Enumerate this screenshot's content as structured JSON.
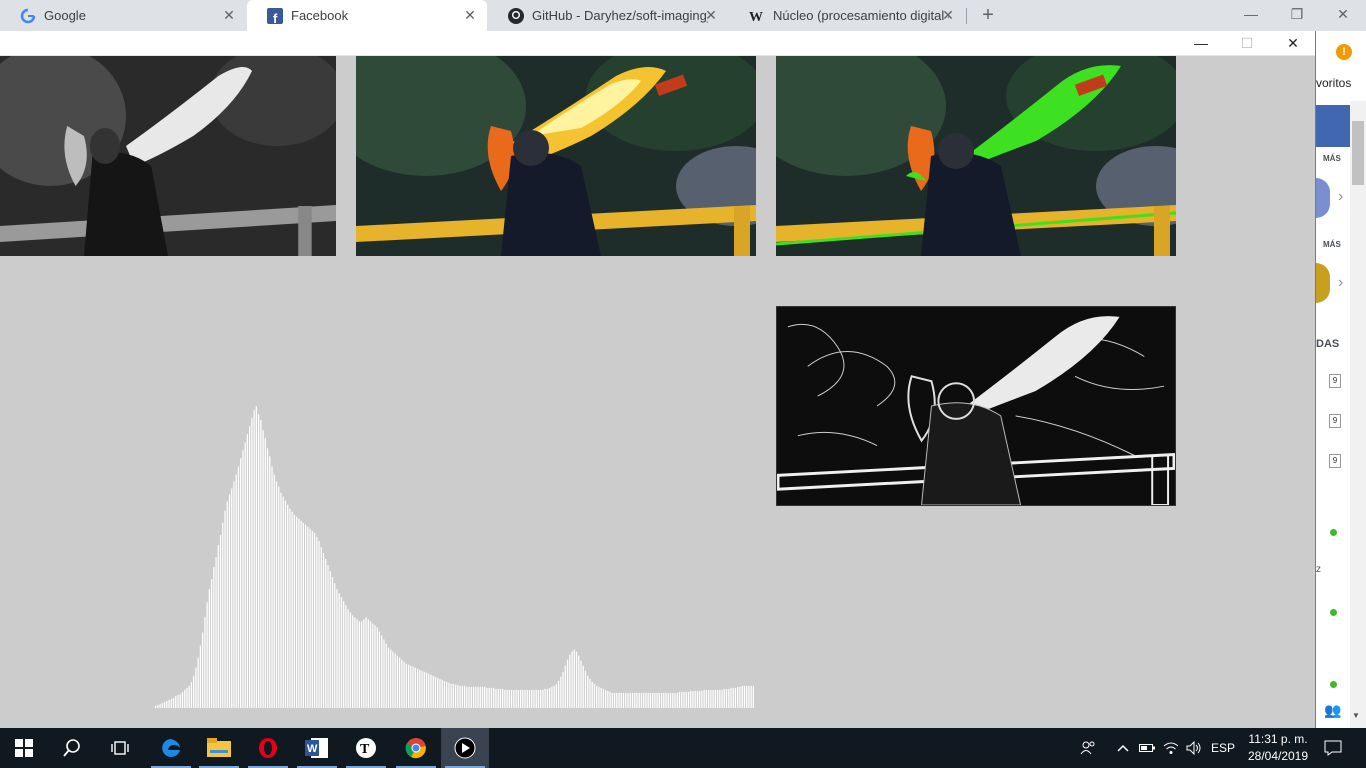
{
  "browser": {
    "tabs": [
      {
        "title": "Google",
        "icon": "google-icon"
      },
      {
        "title": "Facebook",
        "icon": "facebook-icon",
        "active": true
      },
      {
        "title": "GitHub - Daryhez/soft-imaging_v",
        "icon": "github-icon"
      },
      {
        "title": "Núcleo (procesamiento digital de",
        "icon": "wikipedia-icon"
      }
    ],
    "new_tab": "+"
  },
  "background_page": {
    "favoritos_fragment": "voritos",
    "mas_1": "MÁS",
    "mas_2": "MÁS",
    "das_fragment": "DAS",
    "box_values": [
      "9",
      "9",
      "9"
    ],
    "z_fragment": "z",
    "alert_icon": "!"
  },
  "app_window": {
    "panels": [
      "grayscale-image",
      "original-image",
      "highlighted-image",
      "histogram",
      "edge-detection-image"
    ]
  },
  "chart_data": {
    "type": "bar",
    "title": "",
    "xlabel": "",
    "ylabel": "",
    "bar_color": "#ffffff",
    "x": [
      0,
      255
    ],
    "xlim": [
      0,
      255
    ],
    "ylim": [
      0,
      300
    ],
    "grid": false,
    "values": [
      2,
      3,
      4,
      5,
      6,
      7,
      8,
      9,
      10,
      12,
      13,
      14,
      16,
      18,
      20,
      22,
      26,
      32,
      40,
      50,
      62,
      75,
      90,
      105,
      118,
      128,
      140,
      150,
      162,
      172,
      184,
      196,
      205,
      212,
      218,
      225,
      232,
      240,
      248,
      256,
      264,
      272,
      280,
      288,
      296,
      300,
      292,
      286,
      276,
      268,
      258,
      250,
      240,
      232,
      225,
      220,
      214,
      210,
      206,
      202,
      198,
      195,
      192,
      190,
      188,
      186,
      184,
      182,
      180,
      178,
      176,
      174,
      170,
      166,
      160,
      154,
      148,
      142,
      136,
      130,
      124,
      118,
      114,
      110,
      106,
      102,
      98,
      95,
      92,
      90,
      88,
      86,
      86,
      88,
      90,
      88,
      86,
      84,
      82,
      80,
      76,
      72,
      68,
      64,
      60,
      58,
      56,
      54,
      52,
      50,
      48,
      46,
      44,
      43,
      42,
      41,
      40,
      39,
      38,
      37,
      36,
      35,
      34,
      33,
      32,
      31,
      30,
      29,
      28,
      27,
      26,
      25,
      24,
      24,
      23,
      23,
      22,
      22,
      22,
      21,
      21,
      21,
      21,
      21,
      21,
      21,
      21,
      21,
      20,
      20,
      20,
      20,
      19,
      19,
      19,
      19,
      18,
      18,
      18,
      18,
      18,
      18,
      18,
      18,
      18,
      18,
      18,
      18,
      18,
      18,
      18,
      18,
      18,
      18,
      19,
      19,
      20,
      21,
      22,
      24,
      27,
      31,
      36,
      42,
      48,
      53,
      56,
      58,
      56,
      52,
      47,
      42,
      37,
      32,
      29,
      26,
      24,
      22,
      21,
      20,
      19,
      18,
      17,
      16,
      15,
      15,
      15,
      15,
      15,
      15,
      15,
      15,
      15,
      15,
      15,
      15,
      15,
      15,
      15,
      15,
      15,
      15,
      15,
      15,
      15,
      15,
      15,
      15,
      15,
      15,
      15,
      15,
      15,
      15,
      16,
      16,
      16,
      16,
      16,
      17,
      17,
      17,
      17,
      17,
      17,
      18,
      18,
      18,
      18,
      18,
      18,
      18,
      18,
      18,
      19,
      19,
      19,
      20,
      20,
      20,
      21,
      21,
      22,
      22,
      22,
      22,
      22,
      22
    ]
  },
  "taskbar": {
    "apps": [
      "start-icon",
      "search-icon",
      "task-view-icon",
      "edge-icon",
      "file-explorer-icon",
      "opera-icon",
      "word-icon",
      "typora-icon",
      "chrome-icon",
      "media-player-icon"
    ],
    "language": "ESP",
    "time": "11:31 p. m.",
    "date": "28/04/2019"
  }
}
